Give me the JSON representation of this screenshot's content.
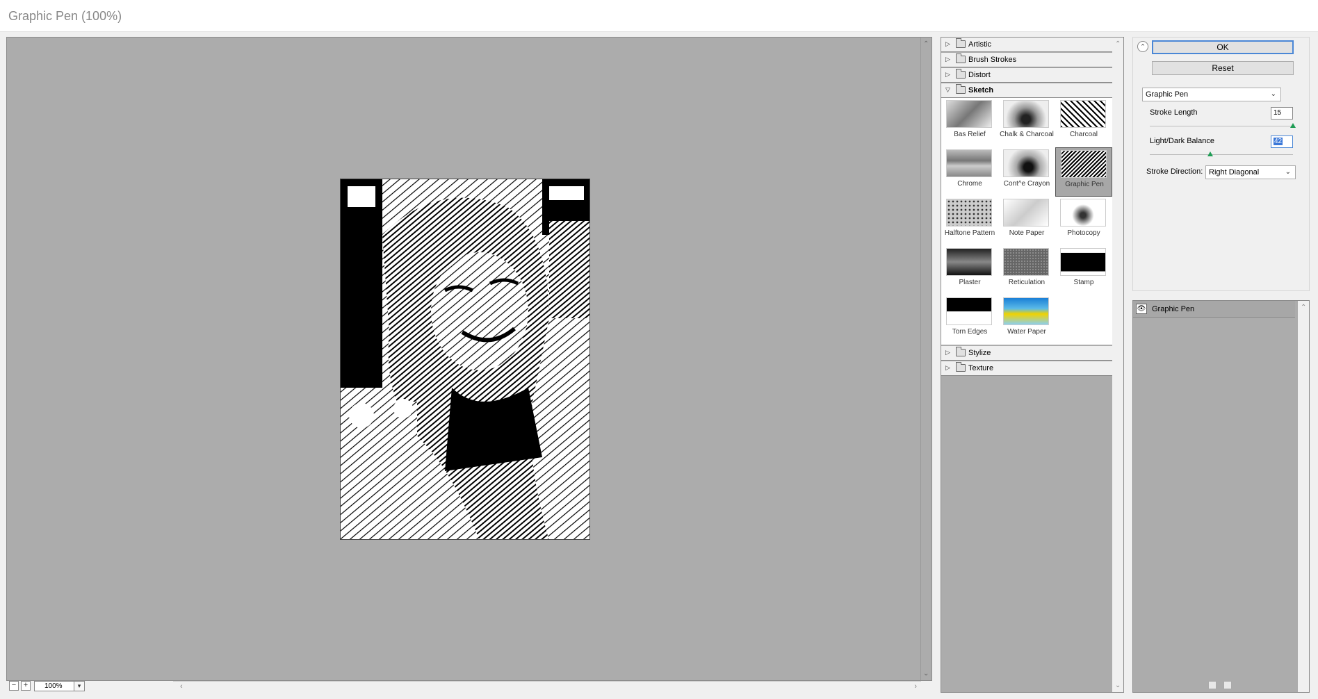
{
  "window": {
    "title": "Graphic Pen (100%)"
  },
  "preview": {
    "zoom": "100%",
    "zoom_out": "−",
    "zoom_in": "+"
  },
  "gallery": {
    "categories_top": [
      {
        "label": "Artistic"
      },
      {
        "label": "Brush Strokes"
      },
      {
        "label": "Distort"
      },
      {
        "label": "Sketch"
      }
    ],
    "categories_bottom": [
      {
        "label": "Stylize"
      },
      {
        "label": "Texture"
      }
    ],
    "filters": [
      {
        "label": "Bas Relief"
      },
      {
        "label": "Chalk & Charcoal"
      },
      {
        "label": "Charcoal"
      },
      {
        "label": "Chrome"
      },
      {
        "label": "Cont^e Crayon"
      },
      {
        "label": "Graphic Pen",
        "selected": true
      },
      {
        "label": "Halftone Pattern"
      },
      {
        "label": "Note Paper"
      },
      {
        "label": "Photocopy"
      },
      {
        "label": "Plaster"
      },
      {
        "label": "Reticulation"
      },
      {
        "label": "Stamp"
      },
      {
        "label": "Torn Edges"
      },
      {
        "label": "Water Paper"
      }
    ]
  },
  "settings": {
    "ok": "OK",
    "reset": "Reset",
    "filter": "Graphic Pen",
    "stroke_length": {
      "label": "Stroke Length",
      "value": "15",
      "max": 15
    },
    "balance": {
      "label": "Light/Dark Balance",
      "value": "42",
      "max": 100
    },
    "direction": {
      "label": "Stroke Direction:",
      "value": "Right Diagonal"
    }
  },
  "layers": {
    "items": [
      {
        "label": "Graphic Pen"
      }
    ]
  },
  "colors": {
    "accent": "#4a87d6",
    "canvas": "#acacac",
    "knob": "#1f9d55"
  }
}
